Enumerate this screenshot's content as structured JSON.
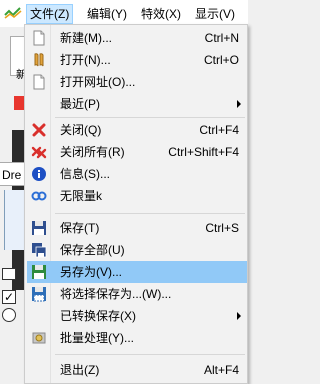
{
  "menubar": {
    "items": [
      {
        "label": "文件(Z)"
      },
      {
        "label": "编辑(Y)"
      },
      {
        "label": "特效(X)"
      },
      {
        "label": "显示(V)"
      }
    ]
  },
  "background": {
    "partial_text_1": "新",
    "partial_text_2": "Dre",
    "check_mark": "✓"
  },
  "file_menu": {
    "items": [
      {
        "label": "新建(M)...",
        "shortcut": "Ctrl+N",
        "icon": "new-file-icon"
      },
      {
        "label": "打开(N)...",
        "shortcut": "Ctrl+O",
        "icon": "open-icon"
      },
      {
        "label": "打开网址(O)...",
        "shortcut": "",
        "icon": "open-url-icon"
      },
      {
        "label": "最近(P)",
        "shortcut": "",
        "icon": "recent-icon",
        "submenu": true
      },
      {
        "label": "关闭(Q)",
        "shortcut": "Ctrl+F4",
        "icon": "close-icon"
      },
      {
        "label": "关闭所有(R)",
        "shortcut": "Ctrl+Shift+F4",
        "icon": "close-all-icon"
      },
      {
        "label": "信息(S)...",
        "shortcut": "",
        "icon": "info-icon"
      },
      {
        "label": "无限量k",
        "shortcut": "",
        "icon": "infinity-icon"
      },
      {
        "label": "保存(T)",
        "shortcut": "Ctrl+S",
        "icon": "save-icon"
      },
      {
        "label": "保存全部(U)",
        "shortcut": "",
        "icon": "save-all-icon"
      },
      {
        "label": "另存为(V)...",
        "shortcut": "",
        "icon": "save-as-icon",
        "highlighted": true
      },
      {
        "label": "将选择保存为...(W)...",
        "shortcut": "",
        "icon": "save-selection-icon"
      },
      {
        "label": "已转换保存(X)",
        "shortcut": "",
        "icon": "converted-save-icon",
        "submenu": true
      },
      {
        "label": "批量处理(Y)...",
        "shortcut": "",
        "icon": "batch-icon"
      },
      {
        "label": "退出(Z)",
        "shortcut": "Alt+F4",
        "icon": "exit-icon"
      }
    ]
  },
  "colors": {
    "highlight": "#91c9f7",
    "active_menu": "#cce8ff",
    "close_red": "#d9302c",
    "info_blue": "#1d4fc4"
  }
}
